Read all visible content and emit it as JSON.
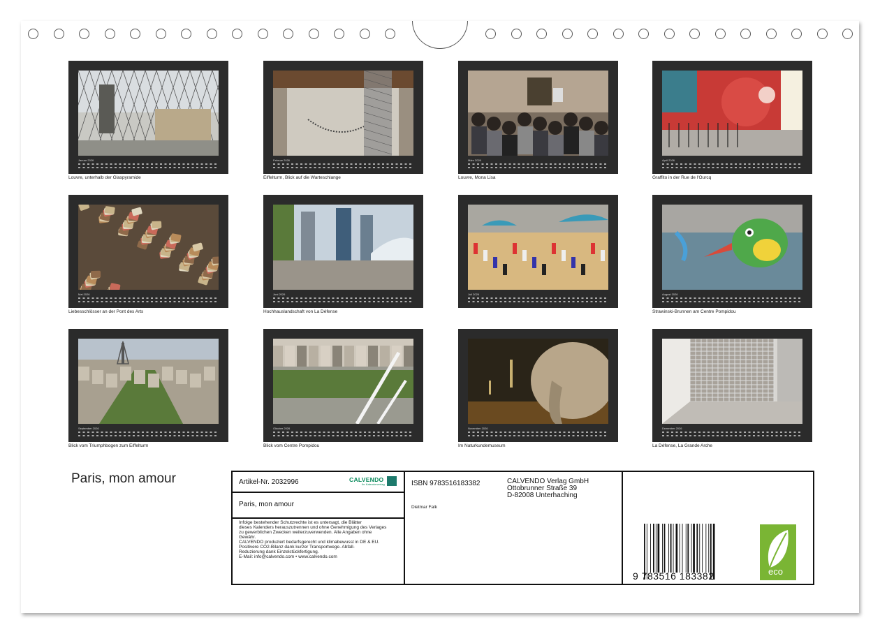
{
  "months": [
    {
      "label": "Januar 2026",
      "caption": "Louvre, unterhalb der Glaspyramide",
      "scene": "pyramid"
    },
    {
      "label": "Februar 2026",
      "caption": "Eiffelturm, Blick auf die Warteschlange",
      "scene": "eiffel-below"
    },
    {
      "label": "März 2026",
      "caption": "Louvre, Mona Lisa",
      "scene": "monalisa"
    },
    {
      "label": "April 2026",
      "caption": "Graffito in der Rue de l'Ourcq",
      "scene": "graffiti"
    },
    {
      "label": "Mai 2026",
      "caption": "Liebesschlösser an der Pont des Arts",
      "scene": "locks"
    },
    {
      "label": "Juni 2026",
      "caption": "Hochhauslandschaft von La Défense",
      "scene": "defense"
    },
    {
      "label": "Juli 2026",
      "caption": "",
      "scene": "beach"
    },
    {
      "label": "August 2026",
      "caption": "Strawinski-Brunnen am Centre Pompidou",
      "scene": "fountain"
    },
    {
      "label": "September 2026",
      "caption": "Blick vom Triumphbogen zum Eiffelturm",
      "scene": "city"
    },
    {
      "label": "Oktober 2026",
      "caption": "Blick vom Centre Pompidou",
      "scene": "pompidou"
    },
    {
      "label": "November 2026",
      "caption": "Im Naturkundemuseum",
      "scene": "elephant"
    },
    {
      "label": "Dezember 2026",
      "caption": "La Défense, La Grande Arche",
      "scene": "arche"
    }
  ],
  "title": "Paris, mon amour",
  "info": {
    "article": "Artikel-Nr. 2032996",
    "logo": "CALVENDO",
    "logo_sub": "Ihr Kalenderverlag",
    "name": "Paris, mon amour",
    "legal": [
      "Infolge bestehender Schutzrechte ist es untersagt, die Blätter",
      "dieses Kalenders herauszutrennen und ohne Genehmigung des Verlages",
      "zu gewerblichen Zwecken weiterzuverwenden. Alle Angaben ohne",
      "Gewähr.",
      "CALVENDO produziert bedarfsgerecht und klimabewusst in DE & EU.",
      "Positivere CO2-Bilanz dank kurzer Transportwege. Abfall-",
      "Reduzierung dank Einzelstückfertigung.",
      "E-Mail: info@calvendo.com • www.calvendo.com"
    ],
    "isbn": "ISBN 9783516183382",
    "author": "Dietmar Falk",
    "publisher": [
      "CALVENDO Verlag GmbH",
      "Ottobrunner Straße 39",
      "D-82008 Unterhaching"
    ],
    "barcode_text": "9 783516 183382",
    "eco_label": "eco"
  },
  "colors": {
    "frame": "#2b2b2b",
    "eco": "#7ab534",
    "calvendo": "#0a8a5c"
  }
}
